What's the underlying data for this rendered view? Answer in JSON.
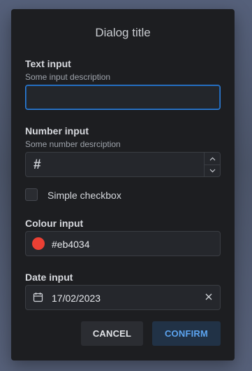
{
  "dialog": {
    "title": "Dialog title"
  },
  "text_input": {
    "label": "Text input",
    "description": "Some input description",
    "value": ""
  },
  "number_input": {
    "label": "Number input",
    "description": "Some number desrciption",
    "prefix": "#",
    "value": ""
  },
  "checkbox": {
    "label": "Simple checkbox",
    "checked": false
  },
  "colour_input": {
    "label": "Colour input",
    "value": "#eb4034",
    "swatch_color": "#eb4034"
  },
  "date_input": {
    "label": "Date input",
    "value": "17/02/2023"
  },
  "buttons": {
    "cancel": "CANCEL",
    "confirm": "CONFIRM"
  },
  "colors": {
    "background": "#4b5468",
    "dialog": "#1d1e21",
    "accent": "#5ca4f0"
  },
  "icons": {
    "calendar": "calendar-icon",
    "clear": "close-icon",
    "increment": "chevron-up-icon",
    "decrement": "chevron-down-icon"
  }
}
